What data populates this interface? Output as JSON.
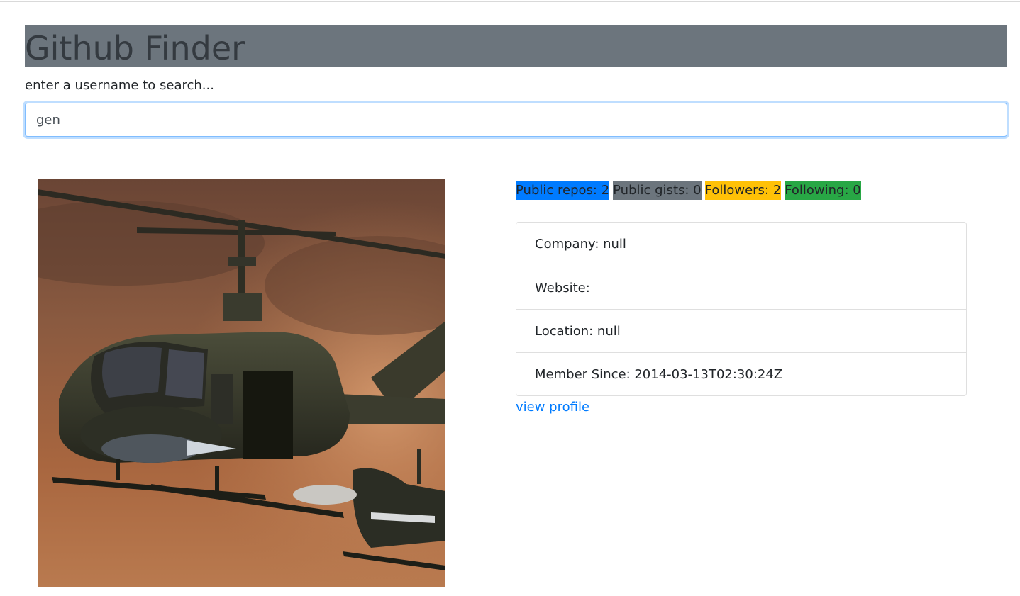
{
  "header": {
    "title": "Github Finder"
  },
  "search": {
    "prompt": "enter a username to search...",
    "value": "gen"
  },
  "profile": {
    "avatar_alt": "user avatar",
    "badges": [
      {
        "label": "Public repos: 2",
        "color": "#007bff"
      },
      {
        "label": "Public gists: 0",
        "color": "#6c757d"
      },
      {
        "label": "Followers: 2",
        "color": "#ffc107"
      },
      {
        "label": "Following: 0",
        "color": "#28a745"
      }
    ],
    "details": [
      {
        "label": "Company: null"
      },
      {
        "label": "Website:"
      },
      {
        "label": "Location: null"
      },
      {
        "label": "Member Since: 2014-03-13T02:30:24Z"
      }
    ],
    "link": {
      "label": "view profile"
    }
  },
  "colors": {
    "header_bg": "#6c757d",
    "link": "#007bff",
    "focus_border": "#80bdff"
  }
}
